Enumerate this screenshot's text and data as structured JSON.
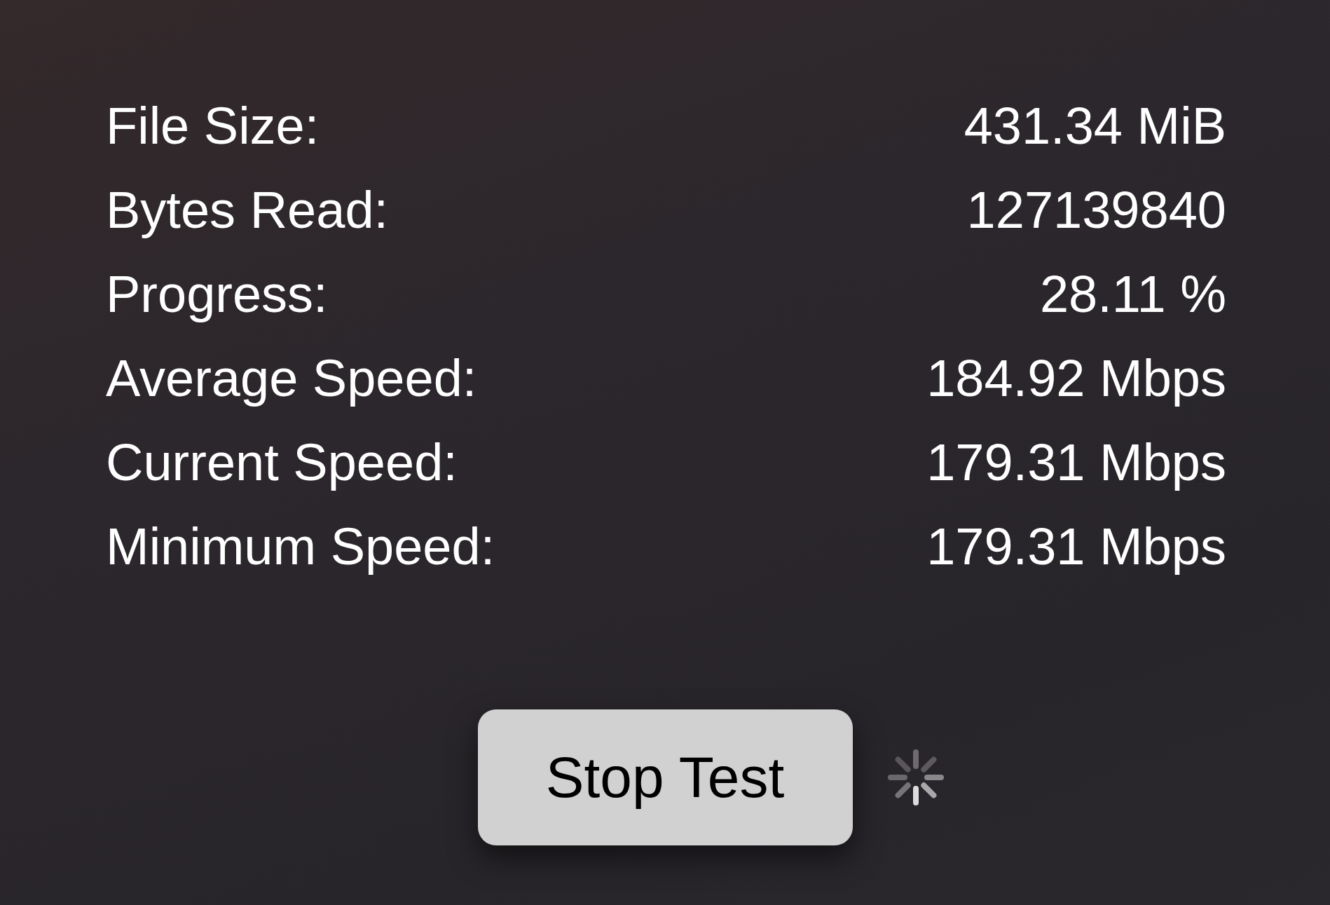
{
  "stats": [
    {
      "label": "File Size:",
      "value": "431.34 MiB"
    },
    {
      "label": "Bytes Read:",
      "value": "127139840"
    },
    {
      "label": "Progress:",
      "value": "28.11 %"
    },
    {
      "label": "Average Speed:",
      "value": "184.92 Mbps"
    },
    {
      "label": "Current Speed:",
      "value": "179.31 Mbps"
    },
    {
      "label": "Minimum Speed:",
      "value": "179.31 Mbps"
    }
  ],
  "stop_button": {
    "label": "Stop Test"
  },
  "activity_indicator": {
    "spinning": true
  }
}
